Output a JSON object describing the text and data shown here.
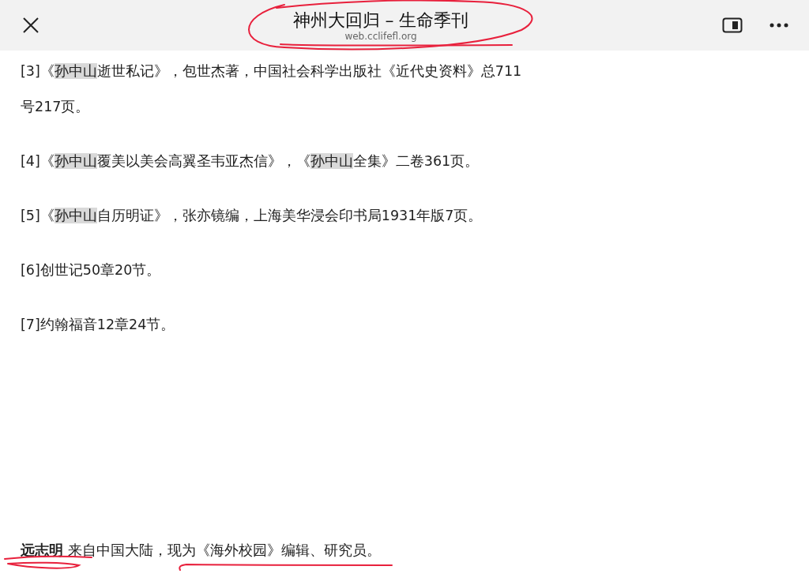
{
  "header": {
    "title": "神州大回归 – 生命季刊",
    "url": "web.cclifefl.org"
  },
  "notes": [
    [
      {
        "text": "[3]《",
        "highlighted": false
      },
      {
        "text": "孙中山",
        "highlighted": true
      },
      {
        "text": "逝世私记》，包世杰著，中国社会科学出版社《近代史资料》总711号217页。",
        "highlighted": false
      }
    ],
    [
      {
        "text": "[4]《",
        "highlighted": false
      },
      {
        "text": "孙中山",
        "highlighted": true
      },
      {
        "text": "覆美以美会高翼圣韦亚杰信》，《",
        "highlighted": false
      },
      {
        "text": "孙中山",
        "highlighted": true
      },
      {
        "text": "全集》二卷361页。",
        "highlighted": false
      }
    ],
    [
      {
        "text": "[5]《",
        "highlighted": false
      },
      {
        "text": "孙中山",
        "highlighted": true
      },
      {
        "text": "自历明证》，张亦镜编，上海美华浸会印书局1931年版7页。",
        "highlighted": false
      }
    ],
    [
      {
        "text": "[6]创世记50章20节。",
        "highlighted": false
      }
    ],
    [
      {
        "text": "[7]约翰福音12章24节。",
        "highlighted": false
      }
    ]
  ],
  "author_note": "**远志明** 来自中国大陆，现为《海外校园》编辑、研究员。"
}
